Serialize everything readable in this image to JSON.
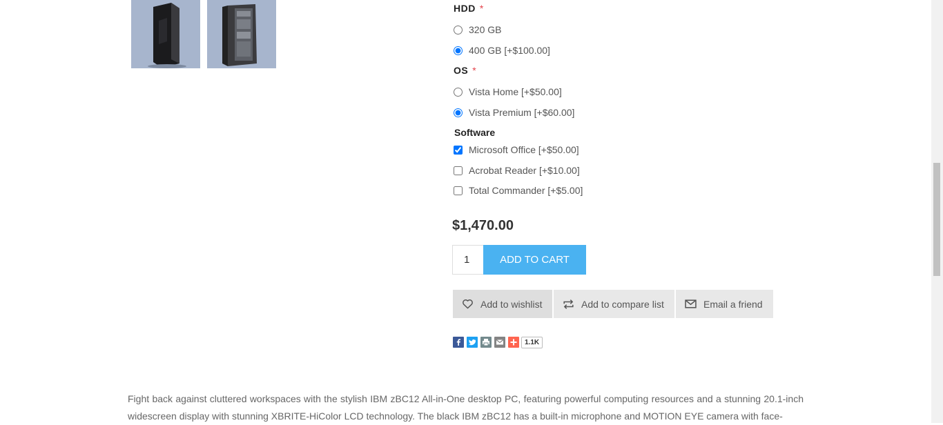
{
  "product": {
    "price": "$1,470.00",
    "quantity": "1",
    "add_to_cart_label": "ADD TO CART"
  },
  "attributes": {
    "hdd": {
      "label": "HDD",
      "required_marker": "*",
      "options": [
        {
          "label": "320 GB",
          "selected": false
        },
        {
          "label": "400 GB [+$100.00]",
          "selected": true
        }
      ]
    },
    "os": {
      "label": "OS",
      "required_marker": "*",
      "options": [
        {
          "label": "Vista Home [+$50.00]",
          "selected": false
        },
        {
          "label": "Vista Premium [+$60.00]",
          "selected": true
        }
      ]
    },
    "software": {
      "label": "Software",
      "options": [
        {
          "label": "Microsoft Office [+$50.00]",
          "checked": true
        },
        {
          "label": "Acrobat Reader [+$10.00]",
          "checked": false
        },
        {
          "label": "Total Commander [+$5.00]",
          "checked": false
        }
      ]
    }
  },
  "actions": {
    "wishlist": "Add to wishlist",
    "compare": "Add to compare list",
    "email": "Email a friend"
  },
  "share": {
    "icons": [
      "facebook-icon",
      "twitter-icon",
      "print-icon",
      "email-icon",
      "addthis-plus-icon"
    ],
    "count": "1.1K"
  },
  "description": "Fight back against cluttered workspaces with the stylish IBM zBC12 All-in-One desktop PC, featuring powerful computing resources and a stunning 20.1-inch widescreen display with stunning XBRITE-HiColor LCD technology. The black IBM zBC12 has a built-in microphone and MOTION EYE camera with face-",
  "colors": {
    "accent": "#4ab2f1",
    "required": "#e4434b"
  }
}
